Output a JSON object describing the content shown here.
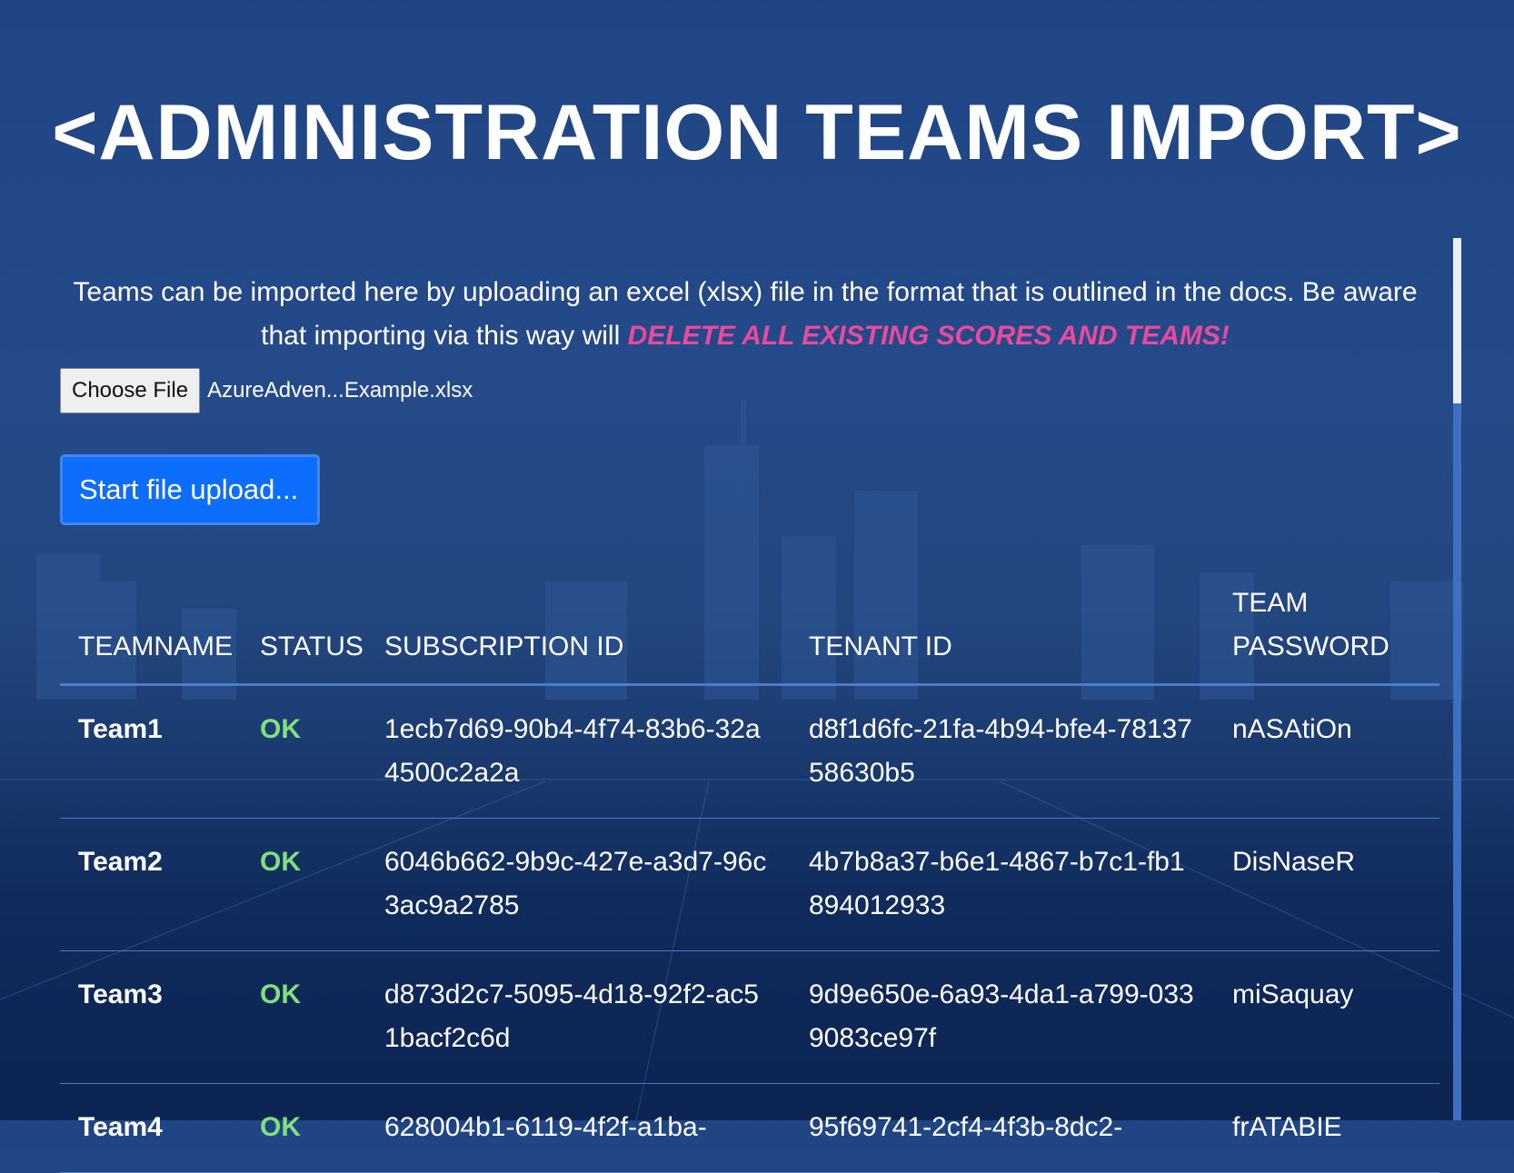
{
  "page": {
    "title": "<ADMINISTRATION TEAMS IMPORT>",
    "intro_text": "Teams can be imported here by uploading an excel (xlsx) file in the format that is outlined in the docs. Be aware that importing via this way will ",
    "intro_warning": "DELETE ALL EXISTING SCORES AND TEAMS!"
  },
  "file_input": {
    "button_label": "Choose File",
    "file_name": "AzureAdven...Example.xlsx"
  },
  "upload": {
    "button_label": "Start file upload..."
  },
  "table": {
    "headers": [
      "TEAMNAME",
      "STATUS",
      "SUBSCRIPTION ID",
      "TENANT ID",
      "TEAM PASSWORD"
    ],
    "rows": [
      [
        "Team1",
        "OK",
        "1ecb7d69-90b4-4f74-83b6-32a4500c2a2a",
        "d8f1d6fc-21fa-4b94-bfe4-7813758630b5",
        "nASAtiOn"
      ],
      [
        "Team2",
        "OK",
        "6046b662-9b9c-427e-a3d7-96c3ac9a2785",
        "4b7b8a37-b6e1-4867-b7c1-fb1894012933",
        "DisNaseR"
      ],
      [
        "Team3",
        "OK",
        "d873d2c7-5095-4d18-92f2-ac51bacf2c6d",
        "9d9e650e-6a93-4da1-a799-0339083ce97f",
        "miSaquay"
      ],
      [
        "Team4",
        "OK",
        "628004b1-6119-4f2f-a1ba-",
        "95f69741-2cf4-4f3b-8dc2-",
        "frATABIE"
      ]
    ]
  },
  "colors": {
    "background": "#1f4585",
    "warning": "#ea4a9b",
    "ok_status": "#7fe07c",
    "primary_button": "#0d6efd"
  }
}
